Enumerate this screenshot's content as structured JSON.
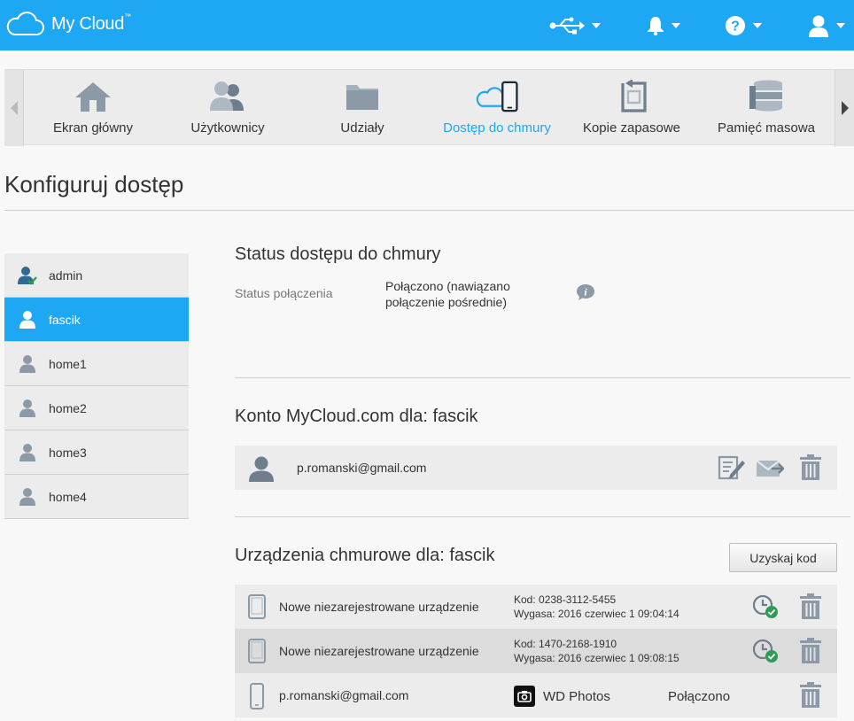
{
  "app": {
    "brand_name": "My Cloud",
    "brand_tm": "™",
    "accent_color": "#1ea7f3"
  },
  "topbar": {
    "icons": [
      "usb-icon",
      "bell-icon",
      "help-icon",
      "user-icon"
    ]
  },
  "nav": {
    "items": [
      {
        "label": "Ekran główny",
        "icon": "home-icon"
      },
      {
        "label": "Użytkownicy",
        "icon": "users-icon"
      },
      {
        "label": "Udziały",
        "icon": "folder-icon"
      },
      {
        "label": "Dostęp do chmury",
        "icon": "cloud-access-icon",
        "active": true
      },
      {
        "label": "Kopie zapasowe",
        "icon": "backup-icon"
      },
      {
        "label": "Pamięć masowa",
        "icon": "storage-icon"
      }
    ]
  },
  "page": {
    "title": "Konfiguruj dostęp"
  },
  "users": [
    {
      "name": "admin",
      "admin": true
    },
    {
      "name": "fascik",
      "active": true
    },
    {
      "name": "home1"
    },
    {
      "name": "home2"
    },
    {
      "name": "home3"
    },
    {
      "name": "home4"
    }
  ],
  "status_section": {
    "title": "Status dostępu do chmury",
    "connection_label": "Status połączenia",
    "connection_value": "Połączono (nawiązano połączenie pośrednie)"
  },
  "account_section": {
    "title": "Konto MyCloud.com dla: fascik",
    "email": "p.romanski@gmail.com"
  },
  "devices_section": {
    "title": "Urządzenia chmurowe dla: fascik",
    "get_code_label": "Uzyskaj kod",
    "devices": [
      {
        "name": "Nowe niezarejestrowane urządzenie",
        "code": "Kod: 0238-3112-5455",
        "expires": "Wygasa: 2016 czerwiec 1 09:04:14"
      },
      {
        "name": "Nowe niezarejestrowane urządzenie",
        "code": "Kod: 1470-2168-1910",
        "expires": "Wygasa: 2016 czerwiec 1 09:08:15"
      },
      {
        "name": "p.romanski@gmail.com",
        "app": "WD Photos",
        "status": "Połączono"
      }
    ]
  }
}
